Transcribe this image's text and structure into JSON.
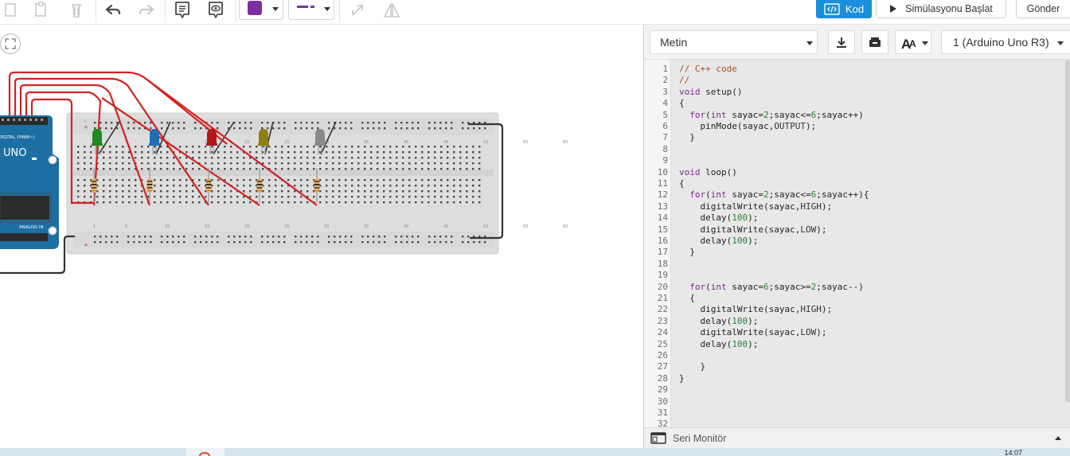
{
  "toolbar": {
    "kod_label": "Kod",
    "simulate_label": "Simülasyonu Başlat",
    "send_label": "Gönder",
    "fill_color": "#7b2fa0",
    "line_color": "#7b2fa0"
  },
  "circuit": {
    "board_label": "UNO",
    "digital_label": "DIGITAL (PWM~)",
    "analog_label": "ANALOG IN",
    "led_colors": [
      "#1d8a1d",
      "#1f6fb4",
      "#b11818",
      "#8f7d10",
      "#8a8a8a"
    ],
    "wire_color": "#d32222",
    "breadboard_numbers_top": [
      "1",
      "5",
      "10",
      "15",
      "20",
      "25",
      "30",
      "35",
      "40",
      "45",
      "50",
      "55",
      "60"
    ],
    "breadboard_numbers_bottom": [
      "1",
      "5",
      "10",
      "15",
      "20",
      "25",
      "30",
      "35",
      "40",
      "45",
      "50",
      "55",
      "60"
    ]
  },
  "code_panel": {
    "mode": "Metin",
    "device": "1 (Arduino Uno R3)",
    "font_button": "A",
    "serial_monitor": "Seri Monitör"
  },
  "code_lines": [
    "// C++ code",
    "//",
    "void setup()",
    "{",
    "  for(int sayac=2;sayac<=6;sayac++)",
    "    pinMode(sayac,OUTPUT);",
    "  }",
    "",
    "",
    "void loop()",
    "{",
    "  for(int sayac=2;sayac<=6;sayac++){",
    "    digitalWrite(sayac,HIGH);",
    "    delay(100);",
    "    digitalWrite(sayac,LOW);",
    "    delay(100);",
    "  }",
    "",
    "",
    "  for(int sayac=6;sayac>=2;sayac--)",
    "  {",
    "    digitalWrite(sayac,HIGH);",
    "    delay(100);",
    "    digitalWrite(sayac,LOW);",
    "    delay(100);",
    "",
    "    }",
    "}",
    "",
    "",
    "",
    ""
  ],
  "taskbar": {
    "clock": "14:07"
  }
}
